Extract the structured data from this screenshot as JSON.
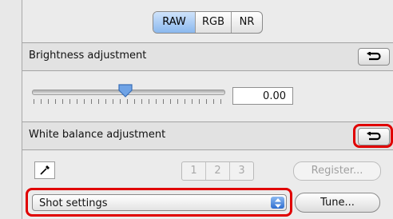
{
  "tabs": [
    {
      "label": "RAW",
      "active": true
    },
    {
      "label": "RGB",
      "active": false
    },
    {
      "label": "NR",
      "active": false
    }
  ],
  "brightness": {
    "title": "Brightness adjustment",
    "value": "0.00"
  },
  "white_balance": {
    "title": "White balance adjustment",
    "preset_buttons": [
      "1",
      "2",
      "3"
    ],
    "register_label": "Register...",
    "mode_selected": "Shot settings",
    "tune_label": "Tune..."
  },
  "highlight_color": "#e00000",
  "accent_color": "#3a7bd5"
}
